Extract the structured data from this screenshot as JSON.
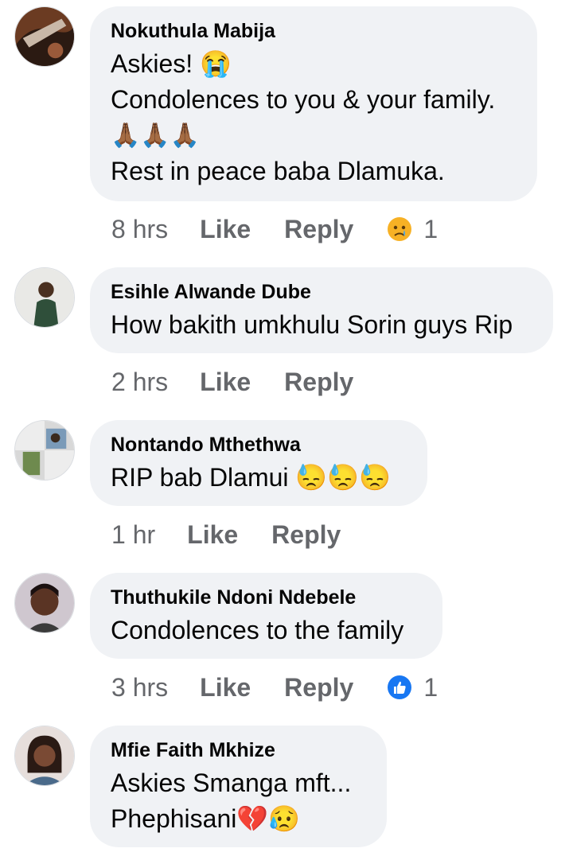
{
  "comments": [
    {
      "author": "Nokuthula Mabija",
      "lines": [
        "Askies! 😭",
        "Condolences to you & your family.",
        "🙏🏾🙏🏾🙏🏾",
        "Rest in peace baba Dlamuka."
      ],
      "time": "8 hrs",
      "like_label": "Like",
      "reply_label": "Reply",
      "reaction_icon": "sad-reaction",
      "reaction_count": "1"
    },
    {
      "author": "Esihle Alwande Dube",
      "lines": [
        "How bakith umkhulu Sorin guys Rip"
      ],
      "time": "2 hrs",
      "like_label": "Like",
      "reply_label": "Reply"
    },
    {
      "author": "Nontando Mthethwa",
      "lines": [
        "RIP bab Dlamui 😓😓😓"
      ],
      "time": "1 hr",
      "like_label": "Like",
      "reply_label": "Reply"
    },
    {
      "author": "Thuthukile Ndoni Ndebele",
      "lines": [
        "Condolences to the family"
      ],
      "time": "3 hrs",
      "like_label": "Like",
      "reply_label": "Reply",
      "reaction_icon": "like-reaction",
      "reaction_count": "1"
    },
    {
      "author": "Mfie Faith Mkhize",
      "lines": [
        "Askies Smanga mft...",
        "Phephisani💔😥"
      ]
    }
  ],
  "colors": {
    "bubble": "#f0f2f5",
    "meta_text": "#65676b",
    "like_blue": "#1877f2",
    "sad_yellow": "#f7b125"
  }
}
